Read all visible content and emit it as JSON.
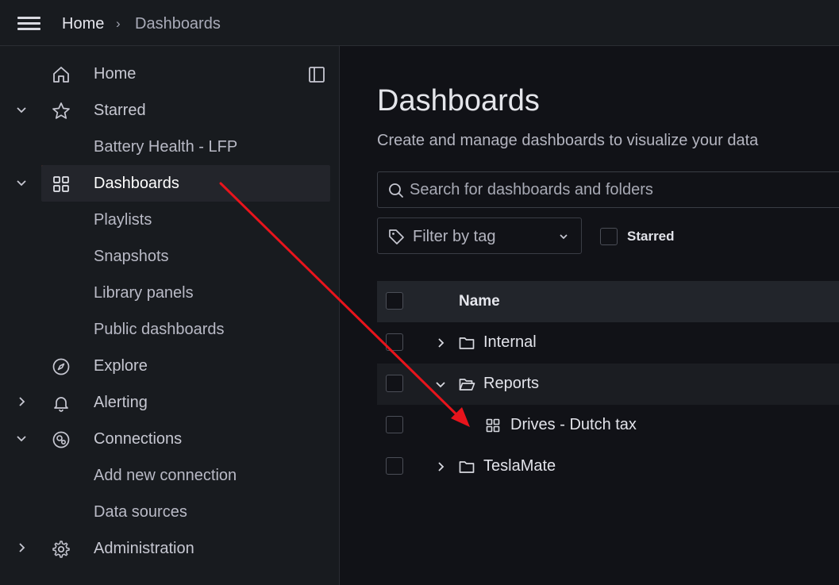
{
  "topbar": {
    "breadcrumb_home": "Home",
    "breadcrumb_separator": "›",
    "breadcrumb_current": "Dashboards"
  },
  "sidebar": {
    "items": [
      {
        "label": "Home",
        "icon": "home-icon"
      },
      {
        "label": "Starred",
        "icon": "star-icon",
        "expanded": true
      },
      {
        "label": "Battery Health - LFP"
      },
      {
        "label": "Dashboards",
        "icon": "apps-icon",
        "expanded": true,
        "active": true
      },
      {
        "label": "Playlists"
      },
      {
        "label": "Snapshots"
      },
      {
        "label": "Library panels"
      },
      {
        "label": "Public dashboards"
      },
      {
        "label": "Explore",
        "icon": "compass-icon"
      },
      {
        "label": "Alerting",
        "icon": "bell-icon",
        "expanded": false
      },
      {
        "label": "Connections",
        "icon": "connections-icon",
        "expanded": true
      },
      {
        "label": "Add new connection"
      },
      {
        "label": "Data sources"
      },
      {
        "label": "Administration",
        "icon": "cog-icon",
        "expanded": false
      }
    ],
    "accent_color": "#f05a28"
  },
  "main": {
    "title": "Dashboards",
    "subtitle": "Create and manage dashboards to visualize your data",
    "search_placeholder": "Search for dashboards and folders",
    "filter_label": "Filter by tag",
    "starred_label": "Starred",
    "table": {
      "header": "Name",
      "rows": [
        {
          "label": "Internal",
          "type": "folder",
          "expanded": false
        },
        {
          "label": "Reports",
          "type": "folder",
          "expanded": true
        },
        {
          "label": "Drives - Dutch tax",
          "type": "dashboard"
        },
        {
          "label": "TeslaMate",
          "type": "folder",
          "expanded": false
        }
      ]
    }
  },
  "annotation": {
    "type": "arrow",
    "color": "#e8141c"
  }
}
